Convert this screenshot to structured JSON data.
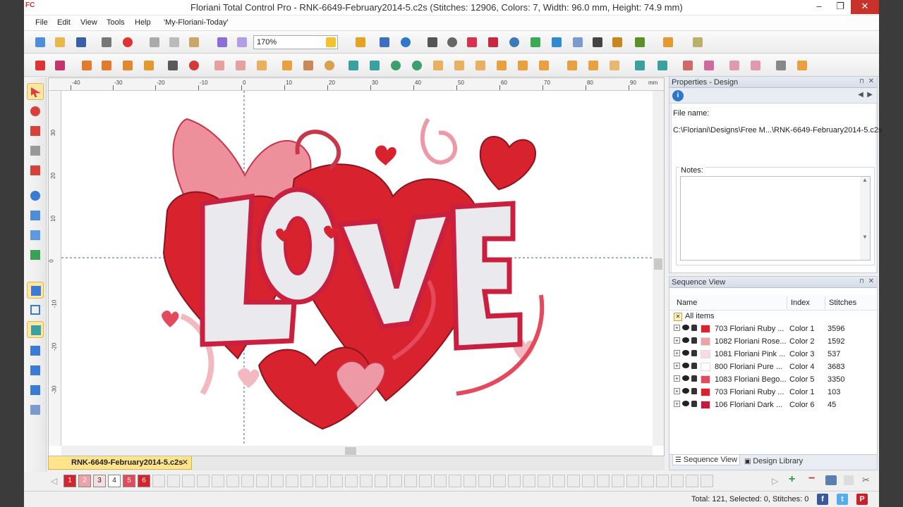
{
  "window": {
    "title": "Floriani Total Control Pro - RNK-6649-February2014-5.c2s (Stitches: 12906, Colors: 7, Width: 96.0 mm, Height: 74.9 mm)",
    "app_icon_text": "FC"
  },
  "menu": {
    "items": [
      "File",
      "Edit",
      "View",
      "Tools",
      "Help",
      "'My-Floriani-Today'"
    ]
  },
  "toolbar": {
    "zoom_value": "170%"
  },
  "ruler": {
    "unit": "mm",
    "h_ticks": [
      "-40",
      "-30",
      "-20",
      "-10",
      "0",
      "10",
      "20",
      "30",
      "40",
      "50",
      "60",
      "70",
      "80",
      "90"
    ],
    "v_ticks": [
      "30",
      "20",
      "10",
      "0",
      "-10",
      "-20",
      "-30"
    ]
  },
  "document_tab": {
    "label": "RNK-6649-February2014-5.c2s",
    "close": "✕"
  },
  "color_bar": {
    "swatches": [
      {
        "num": "1",
        "color": "#d8232f"
      },
      {
        "num": "2",
        "color": "#eea1a8"
      },
      {
        "num": "3",
        "color": "#f6dde0"
      },
      {
        "num": "4",
        "color": "#ffffff"
      },
      {
        "num": "5",
        "color": "#e44a5c"
      },
      {
        "num": "6",
        "color": "#d8232f"
      }
    ]
  },
  "status": {
    "text": "Total: 121, Selected: 0, Stitches: 0"
  },
  "properties": {
    "title": "Properties - Design",
    "file_name_label": "File name:",
    "file_name_value": "C:\\Floriani\\Designs\\Free M...\\RNK-6649-February2014-5.c2s",
    "notes_label": "Notes:",
    "notes_value": ""
  },
  "sequence": {
    "title": "Sequence View",
    "columns": [
      "Name",
      "Index",
      "Stitches"
    ],
    "all_items_label": "All items",
    "rows": [
      {
        "name": "703 Floriani Ruby ...",
        "index": "Color 1",
        "stitches": "3596",
        "swatch": "#d8232f"
      },
      {
        "name": "1082 Floriani Rose...",
        "index": "Color 2",
        "stitches": "1592",
        "swatch": "#eea1a8"
      },
      {
        "name": "1081 Floriani Pink ...",
        "index": "Color 3",
        "stitches": "537",
        "swatch": "#f6dde0"
      },
      {
        "name": "800 Floriani Pure ...",
        "index": "Color 4",
        "stitches": "3683",
        "swatch": "#ffffff"
      },
      {
        "name": "1083 Floriani Bego...",
        "index": "Color 5",
        "stitches": "3350",
        "swatch": "#e44a5c"
      },
      {
        "name": "703 Floriani Ruby ...",
        "index": "Color 1",
        "stitches": "103",
        "swatch": "#d8232f"
      },
      {
        "name": "106 Floriani Dark ...",
        "index": "Color 6",
        "stitches": "45",
        "swatch": "#c01a3c"
      }
    ]
  },
  "panel_tabs": [
    "Sequence View",
    "Design Library"
  ],
  "colors": {
    "accent": "#2f77c9",
    "tab_yellow": "#ffe48c",
    "close_red": "#c7332b"
  }
}
